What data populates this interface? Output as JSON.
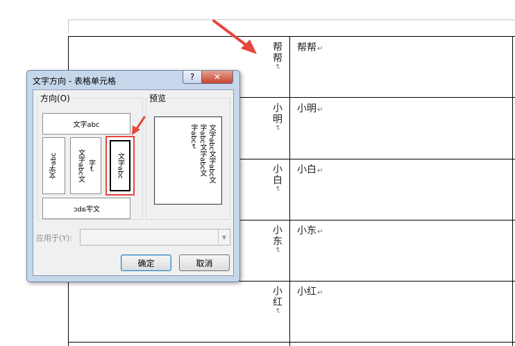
{
  "table": {
    "rows": [
      {
        "vertical": "帮帮",
        "text": "帮帮"
      },
      {
        "vertical": "小明",
        "text": "小明"
      },
      {
        "vertical": "小白",
        "text": "小白"
      },
      {
        "vertical": "小东",
        "text": "小东"
      },
      {
        "vertical": "小红",
        "text": "小红"
      }
    ],
    "para_mark": "↵"
  },
  "dialog": {
    "title": "文字方向 - 表格单元格",
    "help_label": "?",
    "close_label": "✕",
    "orientation_group": "方向(O)",
    "preview_group": "预览",
    "options": {
      "horizontal": "文字abc",
      "rotate_left": "文字abc",
      "stacked_col1": "文字abc文",
      "stacked_col2": "字↵",
      "vertical_selected": "文字abc",
      "upside_down": "文字abc"
    },
    "preview_lines": [
      "文字abc文字abc文",
      "字abc文字abc文",
      "字abc↵"
    ],
    "apply_to_label": "应用于(Y):",
    "apply_to_value": "",
    "ok_label": "确定",
    "cancel_label": "取消"
  },
  "colors": {
    "arrow": "#e8453c",
    "selection": "#e8453c"
  }
}
